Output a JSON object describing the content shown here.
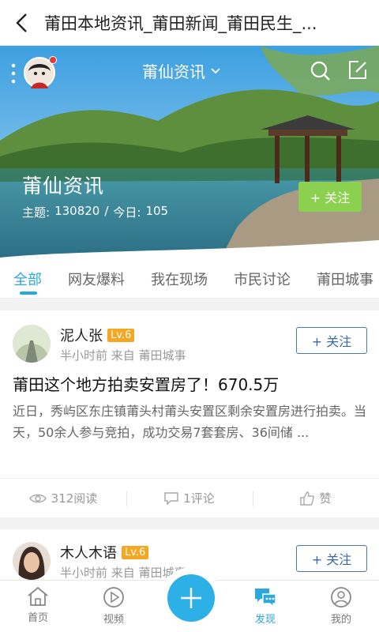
{
  "topbar": {
    "title": "莆田本地资讯_莆田新闻_莆田民生_..."
  },
  "banner": {
    "nav_title": "莆仙资讯",
    "name": "莆仙资讯",
    "topics_label": "主题:",
    "topics_value": "130820",
    "separator": "/",
    "today_label": "今日:",
    "today_value": "105",
    "follow_label": "+ 关注"
  },
  "tabs": [
    "全部",
    "网友爆料",
    "我在现场",
    "市民讨论",
    "莆田城事"
  ],
  "posts": [
    {
      "user": "泥人张",
      "level": "Lv.6",
      "meta": "半小时前  来自 莆田城事",
      "follow_label": "+ 关注",
      "title": "莆田这个地方拍卖安置房了！670.5万",
      "body": "近日，秀屿区东庄镇莆头村莆头安置区剩余安置房进行拍卖。当天，50余人参与竞拍，成功交易7套套房、36间储 ...",
      "reads": "312阅读",
      "comments": "1评论",
      "like": "赞"
    },
    {
      "user": "木人木语",
      "level": "Lv.6",
      "meta": "半小时前  来自 莆田城事",
      "follow_label": "+ 关注"
    }
  ],
  "bottom_nav": [
    "首页",
    "视频",
    "发现",
    "我的"
  ],
  "colors": {
    "accent": "#2aa8e0",
    "follow_green": "#8bd04e",
    "level": "#f5a623"
  }
}
